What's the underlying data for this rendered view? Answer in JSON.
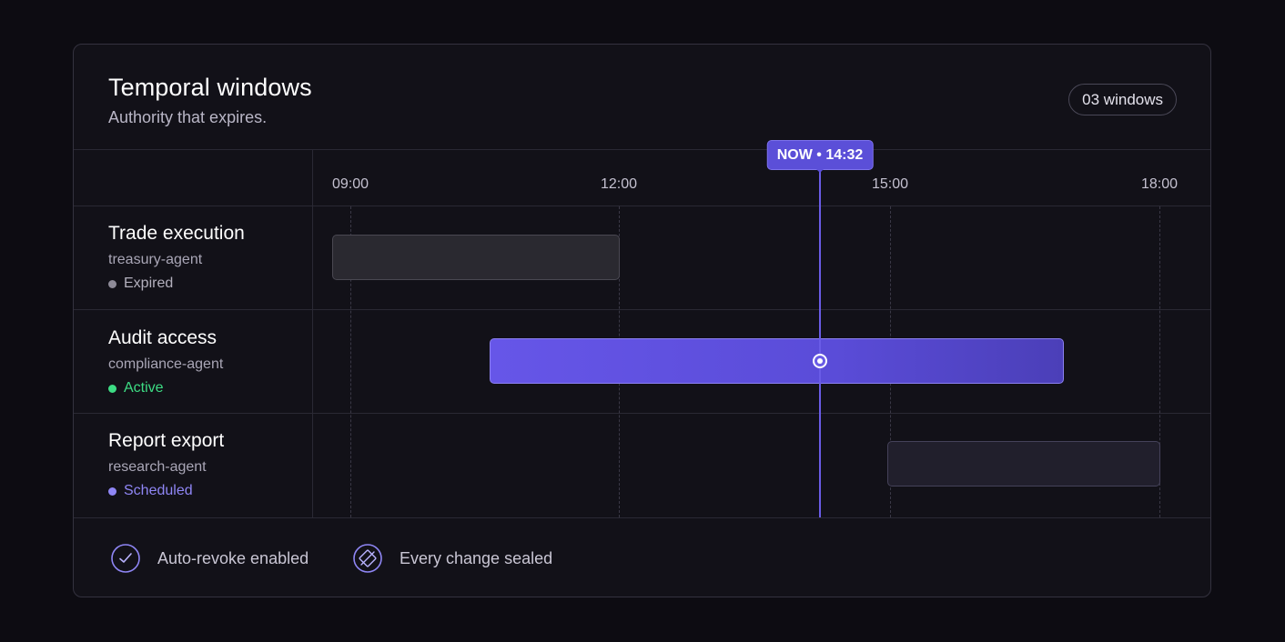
{
  "header": {
    "title": "Temporal windows",
    "subtitle": "Authority that expires.",
    "count_label": "03 windows"
  },
  "timeline": {
    "ticks": [
      "09:00",
      "12:00",
      "15:00",
      "18:00"
    ],
    "now_label": "NOW • 14:32",
    "now_time": "14:32",
    "rows": [
      {
        "title": "Trade execution",
        "agent": "treasury-agent",
        "status": "Expired",
        "status_color": "#8e8b98",
        "window": [
          "09:00",
          "12:00"
        ]
      },
      {
        "title": "Audit access",
        "agent": "compliance-agent",
        "status": "Active",
        "status_color": "#3ddc84",
        "window": [
          "10:45",
          "17:10"
        ]
      },
      {
        "title": "Report export",
        "agent": "research-agent",
        "status": "Scheduled",
        "status_color": "#8f86f5",
        "window": [
          "15:00",
          "18:00"
        ]
      }
    ]
  },
  "footer": {
    "auto_revoke_label": "Auto-revoke enabled",
    "sealed_label": "Every change sealed"
  },
  "colors": {
    "accent": "#6a5ce6",
    "active": "#3ddc84",
    "expired": "#8e8b98",
    "scheduled": "#8f86f5"
  }
}
